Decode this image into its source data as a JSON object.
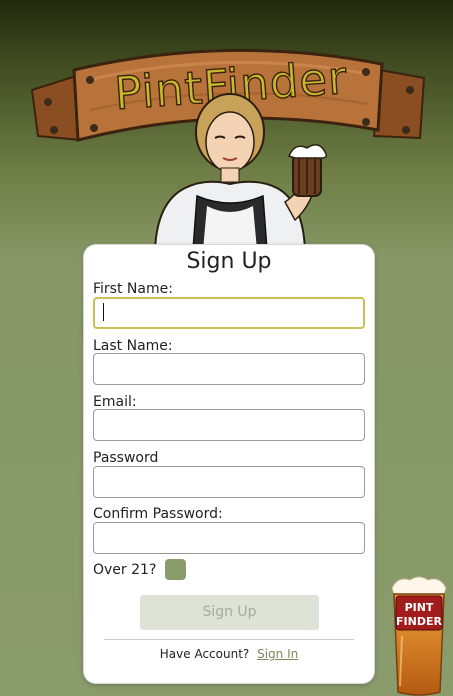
{
  "app": {
    "title": "PintFinder"
  },
  "form": {
    "title": "Sign Up",
    "fields": [
      {
        "label": "First Name:",
        "value": "",
        "focused": true
      },
      {
        "label": "Last Name:",
        "value": ""
      },
      {
        "label": "Email:",
        "value": ""
      },
      {
        "label": "Password",
        "value": ""
      },
      {
        "label": "Confirm Password:",
        "value": ""
      }
    ],
    "over21_label": "Over 21?",
    "over21_checked": false,
    "submit_label": "Sign Up",
    "footer_text": "Have Account?",
    "signin_link": "Sign In"
  },
  "logo": {
    "line1": "PINT",
    "line2": "FINDER"
  },
  "colors": {
    "accent": "#8a9b6c",
    "focus_border": "#cbbf55",
    "link": "#7c8c58",
    "title_gold": "#c9b82a"
  },
  "icons": {
    "header": "wooden-sign-icon",
    "mascot": "barmaid-mascot-icon",
    "logo": "pint-glass-logo-icon"
  }
}
